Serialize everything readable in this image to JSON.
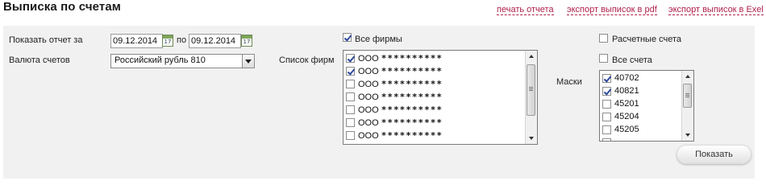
{
  "header": {
    "title": "Выписка по счетам",
    "links": [
      "печать отчета",
      "экспорт выписок в pdf",
      "экспорт выписок в Exel"
    ]
  },
  "filters": {
    "period_label": "Показать отчет за",
    "date_from": "09.12.2014",
    "between_label": "по",
    "date_to": "09.12.2014",
    "calendar_day": "17",
    "currency_label": "Валюта счетов",
    "currency_value": "Российский рубль 810"
  },
  "firms": {
    "all_label": "Все фирмы",
    "all_checked": true,
    "list_label": "Список фирм",
    "items": [
      {
        "prefix": "ООО",
        "name": "**********",
        "checked": true
      },
      {
        "prefix": "ООО",
        "name": "**********",
        "checked": true
      },
      {
        "prefix": "ООО",
        "name": "**********",
        "checked": false
      },
      {
        "prefix": "ООО",
        "name": "**********",
        "checked": false
      },
      {
        "prefix": "ООО",
        "name": "**********",
        "checked": false
      },
      {
        "prefix": "ООО",
        "name": "**********",
        "checked": false
      },
      {
        "prefix": "ООО",
        "name": "**********",
        "checked": false
      }
    ]
  },
  "accounts": {
    "settlement_label": "Расчетные счета",
    "settlement_checked": false,
    "all_label": "Все счета",
    "all_checked": false,
    "masks_label": "Маски",
    "masks": [
      {
        "value": "40702",
        "checked": true
      },
      {
        "value": "40821",
        "checked": true
      },
      {
        "value": "45201",
        "checked": false
      },
      {
        "value": "45204",
        "checked": false
      },
      {
        "value": "45205",
        "checked": false
      }
    ]
  },
  "show_button": "Показать",
  "colors": {
    "link": "#b0204c",
    "panel": "#f1f1f1",
    "check": "#2c4a9c"
  }
}
